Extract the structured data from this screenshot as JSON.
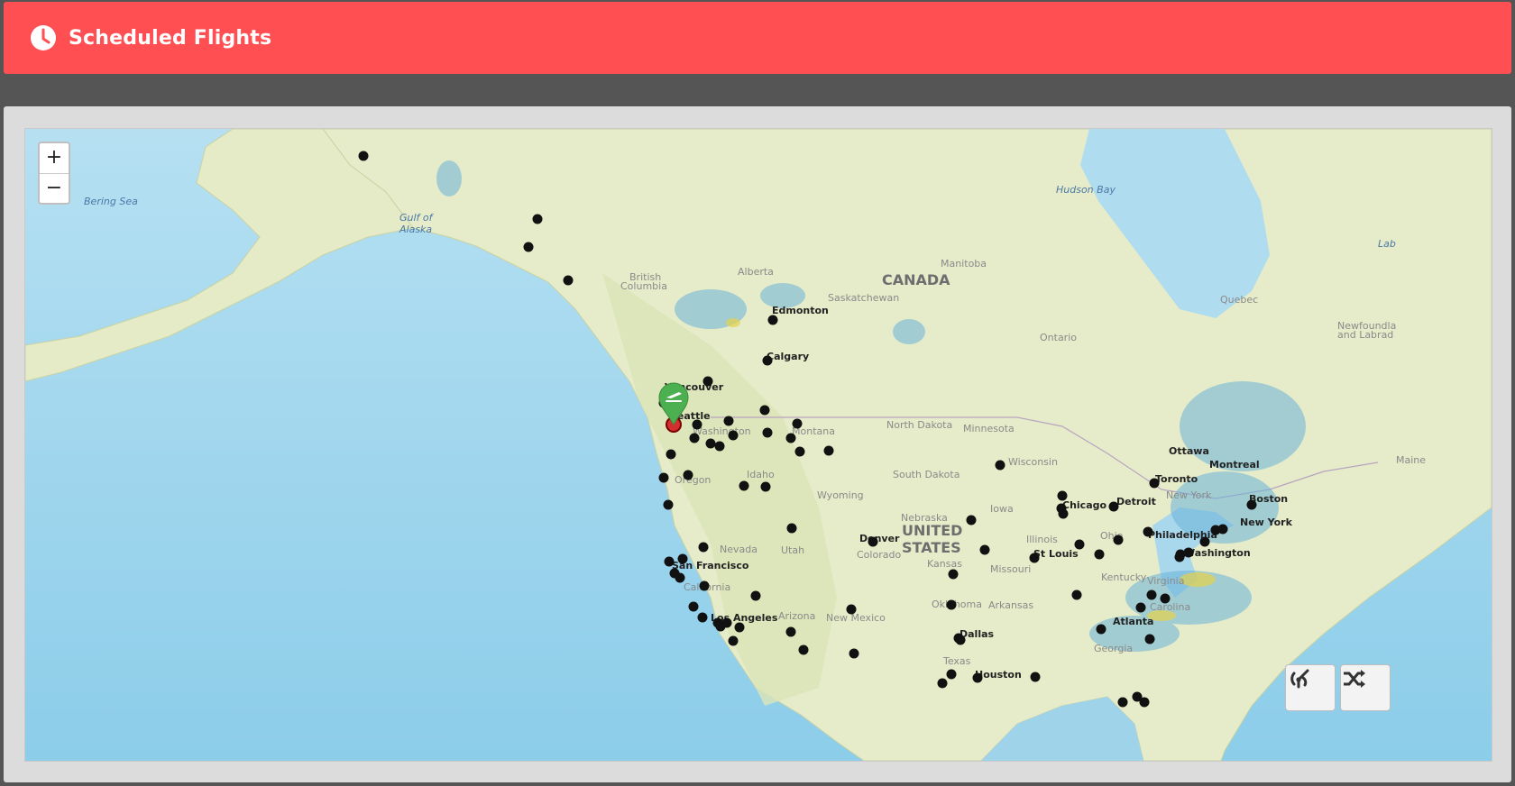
{
  "header": {
    "title": "Scheduled Flights",
    "icon": "clock-icon",
    "color": "#ff4f52"
  },
  "map": {
    "zoom_in_label": "+",
    "zoom_out_label": "−",
    "water_labels": [
      "Bering Sea",
      "Gulf of",
      "Alaska",
      "Hudson Bay",
      "Lab"
    ],
    "country_labels": [
      "CANADA",
      "UNITED",
      "STATES"
    ],
    "region_labels": [
      "British",
      "Columbia",
      "Alberta",
      "Saskatchewan",
      "Manitoba",
      "Ontario",
      "Quebec",
      "Newfoundla",
      "and Labrad",
      "Montana",
      "Idaho",
      "Oregon",
      "Wyoming",
      "North Dakota",
      "South Dakota",
      "Nebraska",
      "Minnesota",
      "Wisconsin",
      "Iowa",
      "Illinois",
      "Ohio",
      "Missouri",
      "Kansas",
      "Colorado",
      "Utah",
      "Nevada",
      "California",
      "Arizona",
      "New Mexico",
      "Oklahoma",
      "Arkansas",
      "Texas",
      "Georgia",
      "Virginia",
      "Carolina",
      "Kentucky",
      "Maine",
      "Washington",
      "New York"
    ],
    "city_labels": [
      "Edmonton",
      "Calgary",
      "Vancouver",
      "Seattle",
      "San Francisco",
      "Los Angeles",
      "Denver",
      "Dallas",
      "Houston",
      "Chicago",
      "Detroit",
      "St Louis",
      "Atlanta",
      "Toronto",
      "Ottawa",
      "Montreal",
      "Boston",
      "New York",
      "Philadelphia",
      "Washington"
    ],
    "selected_airport_marker": "airplane-marker-icon",
    "marker_color": "#4caf50",
    "airport_dot_color": "#111111",
    "buttons": [
      {
        "name": "satellite-icon"
      },
      {
        "name": "shuffle-icon"
      }
    ]
  }
}
